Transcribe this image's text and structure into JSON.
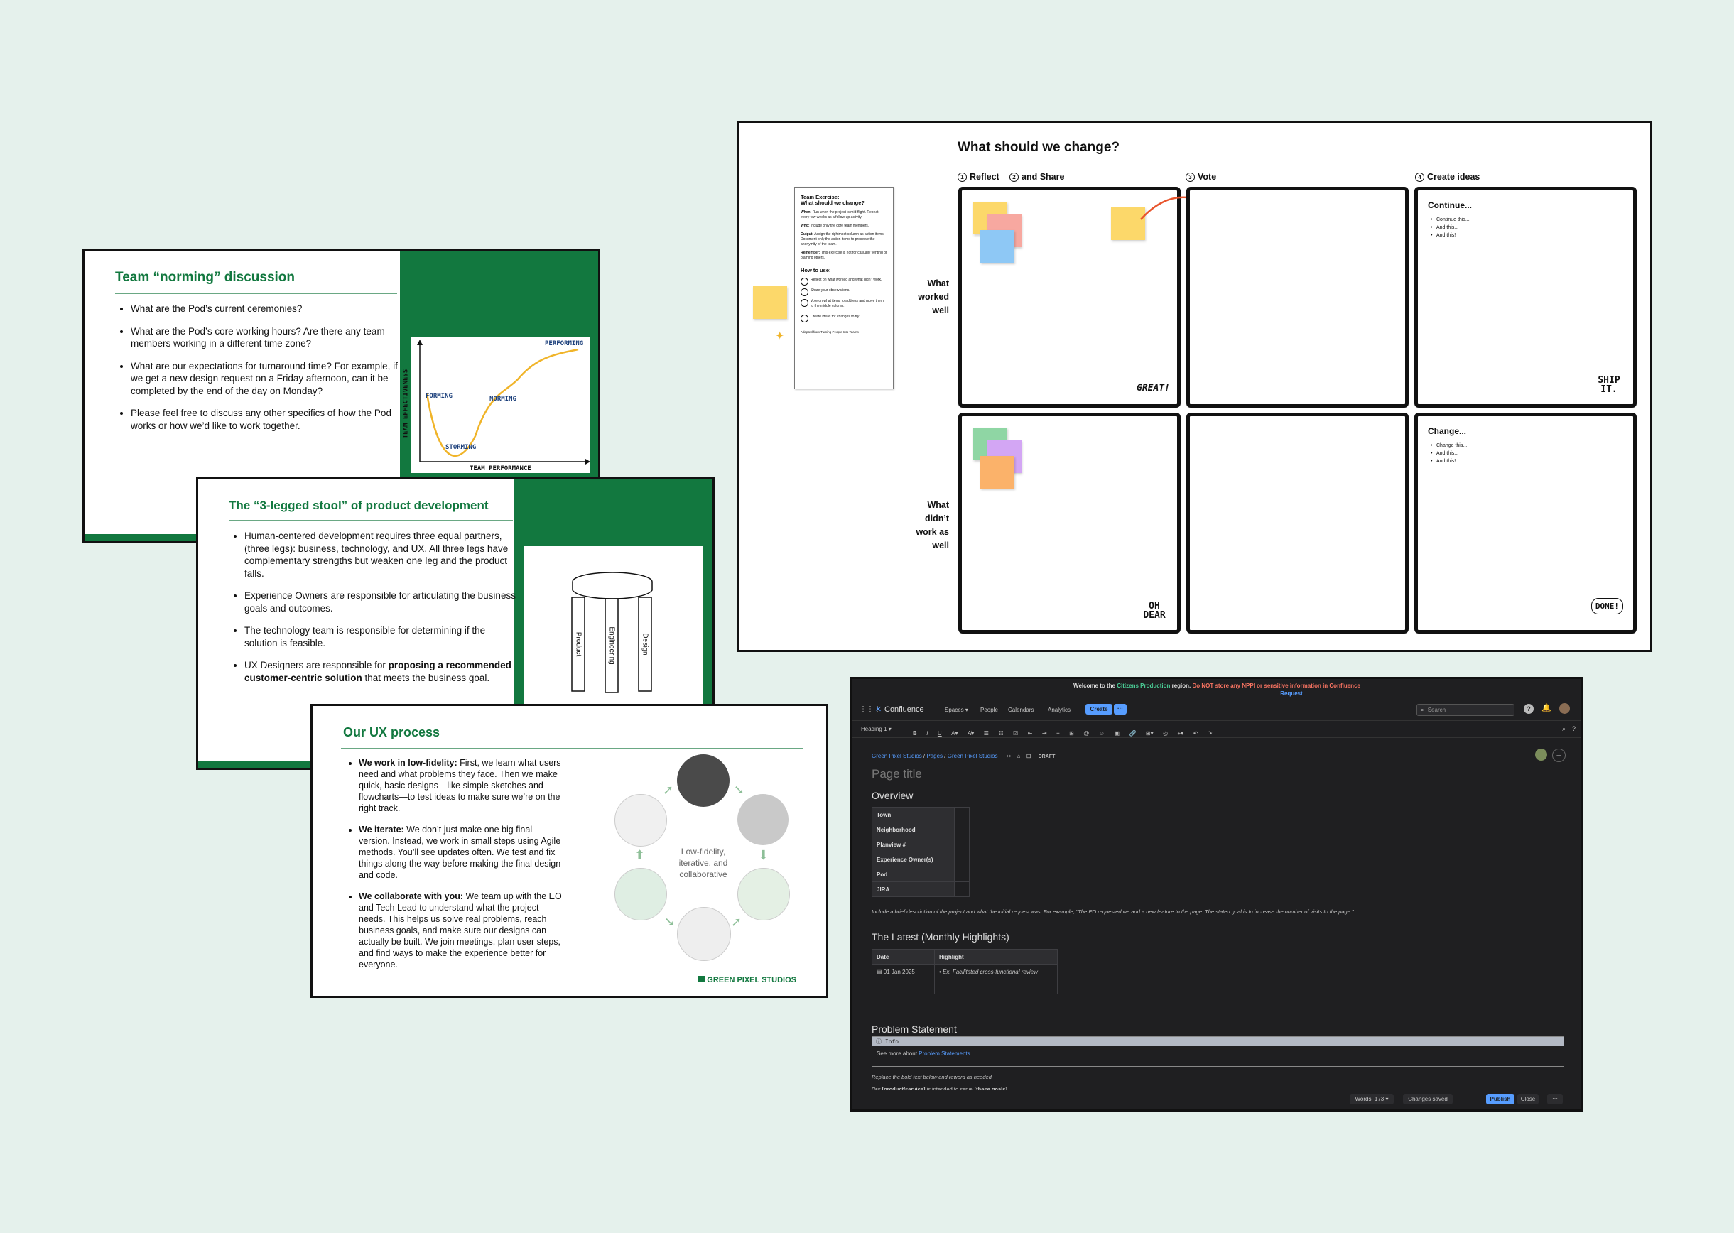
{
  "slide1": {
    "title": "Team “norming” discussion",
    "bullets": [
      "What are the Pod’s current ceremonies?",
      "What are the Pod’s core working hours? Are there any team members working in a different time zone?",
      "What are our expectations for turnaround time? For example, if we get a new design request on a Friday afternoon, can it be completed by the end of the day on Monday?",
      "Please feel free to discuss any other specifics of how the Pod works or how we’d like to work together."
    ],
    "chart": {
      "stages": [
        "Forming",
        "Storming",
        "Norming",
        "Performing"
      ],
      "xlabel": "Team Performance",
      "ylabel": "Team Effectiveness"
    }
  },
  "slide2": {
    "title": "The “3-legged stool” of product development",
    "bullets": [
      {
        "text": "Human-centered development requires three equal partners, (three legs): business, technology, and UX. All three legs have complementary strengths but weaken one leg and the product falls."
      },
      {
        "text": "Experience Owners are responsible for articulating the business goals and outcomes."
      },
      {
        "text": "The technology team is responsible for determining if the solution is feasible."
      },
      {
        "pre": "UX Designers are responsible for ",
        "bold": "proposing a recommended customer-centric solution",
        "post": " that meets the business goal."
      }
    ],
    "legs": [
      "Product",
      "Engineering",
      "Design"
    ]
  },
  "slide3": {
    "title": "Our UX process",
    "bullets": [
      {
        "bold": "We work in low-fidelity:",
        "text": " First, we learn what users need and what problems they face. Then we make quick, basic designs—like simple sketches and flowcharts—to test ideas to make sure we’re on the right track."
      },
      {
        "bold": "We iterate:",
        "text": " We don’t just make one big final version. Instead, we work in small steps using Agile methods. You’ll see updates often. We test and fix things along the way before making the final design and code."
      },
      {
        "bold": "We collaborate with you:",
        "text": " We team up with the EO and Tech Lead to understand what the project needs. This helps us solve real problems, reach business goals, and make sure our designs can actually be built. We join meetings, plan user steps, and find ways to make the experience better for everyone."
      }
    ],
    "cycle_label": [
      "Low-fidelity,",
      "iterative, and",
      "collaborative"
    ],
    "brand": "GREEN PIXEL STUDIOS"
  },
  "board": {
    "title": "What should we change?",
    "columns": [
      {
        "num": "1",
        "label": "Reflect"
      },
      {
        "num": "2",
        "label": "and Share"
      },
      {
        "num": "3",
        "label": "Vote"
      },
      {
        "num": "4",
        "label": "Create ideas"
      }
    ],
    "rows": [
      [
        "What",
        "worked",
        "well"
      ],
      [
        "What",
        "didn’t",
        "work as",
        "well"
      ]
    ],
    "continue": {
      "title": "Continue...",
      "items": [
        "Continue this...",
        "And this...",
        "And this!"
      ]
    },
    "change": {
      "title": "Change...",
      "items": [
        "Change this...",
        "And this...",
        "And this!"
      ]
    },
    "stickers": [
      "GREAT!",
      "SHIP IT.",
      "OH DEAR",
      "DONE!"
    ],
    "instructions": {
      "title": "Team Exercise:",
      "subtitle": "What should we change?",
      "paras": [
        {
          "label": "When:",
          "text": "Run when the project is mid-flight. Repeat every few weeks as a follow-up activity."
        },
        {
          "label": "Who:",
          "text": "Include only the core team members."
        },
        {
          "label": "Output:",
          "text": "Assign the rightmost column as action items. Document only the action items to preserve the anonymity of the team."
        },
        {
          "label": "Remember:",
          "text": "This exercise is not for casually venting or blaming others."
        }
      ],
      "howto_title": "How to use:",
      "steps": [
        "Reflect on what worked and what didn’t work.",
        "Share your observations.",
        "Vote on what items to address and move them to the middle column.",
        "Create ideas for changes to try."
      ],
      "footer": "Adapted from Turning People Into Teams"
    }
  },
  "confluence": {
    "banner": {
      "pre": "Welcome to the ",
      "region": "Citizens Production",
      "mid": " region. ",
      "warning": "Do NOT store any NPPI or sensitive information in Confluence",
      "link": "Request"
    },
    "nav": {
      "product": "Confluence",
      "items": [
        "Spaces",
        "People",
        "Calendars",
        "Analytics"
      ],
      "create": "Create",
      "search_placeholder": "Search"
    },
    "toolbar": {
      "style": "Heading 1"
    },
    "breadcrumbs": [
      "Green Pixel Studios",
      "Pages",
      "Green Pixel Studios"
    ],
    "status": "DRAFT",
    "page_title_placeholder": "Page title",
    "overview": {
      "heading": "Overview",
      "rows": [
        "Town",
        "Neighborhood",
        "Planview #",
        "Experience Owner(s)",
        "Pod",
        "JIRA"
      ],
      "note": "Include a brief description of the project and what the initial request was. For example, \"The EO requested we add a new feature to the page. The stated goal is to increase the number of visits to the page.\""
    },
    "latest": {
      "heading": "The Latest (Monthly Highlights)",
      "headers": [
        "Date",
        "Highlight"
      ],
      "rows": [
        {
          "date": "01 Jan 2025",
          "highlight": "Ex. Facilitated cross-functional review"
        }
      ]
    },
    "problem": {
      "heading": "Problem Statement",
      "panel_label": "Info",
      "panel_pre": "See more about ",
      "panel_link": "Problem Statements",
      "note": "Replace the bold text below and reword as needed.",
      "line_pre": "Our ",
      "line_bold1": "[product/service]",
      "line_mid": " is intended to serve ",
      "line_bold2": "[these goals]"
    },
    "footer": {
      "words": "Words: 173",
      "saved": "Changes saved",
      "publish": "Publish",
      "close": "Close"
    }
  },
  "colors": {
    "green": "#12783f",
    "sticky_yellow": "#fcd86a",
    "confluence_blue": "#579dff"
  }
}
